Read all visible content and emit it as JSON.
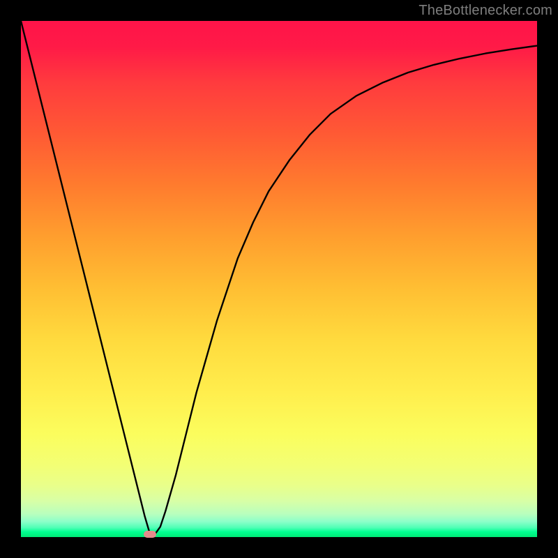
{
  "attribution": "TheBottlenecker.com",
  "chart_data": {
    "type": "line",
    "title": "",
    "xlabel": "",
    "ylabel": "",
    "xlim": [
      0,
      100
    ],
    "ylim": [
      0,
      100
    ],
    "curve": {
      "x": [
        0,
        2,
        4,
        6,
        8,
        10,
        12,
        14,
        16,
        18,
        20,
        22,
        24,
        25,
        26,
        27,
        28,
        30,
        32,
        34,
        36,
        38,
        40,
        42,
        45,
        48,
        52,
        56,
        60,
        65,
        70,
        75,
        80,
        85,
        90,
        95,
        100
      ],
      "y": [
        100,
        92,
        84,
        76,
        68,
        60,
        52,
        44,
        36,
        28,
        20,
        12,
        4,
        0.6,
        0.6,
        2,
        5,
        12,
        20,
        28,
        35,
        42,
        48,
        54,
        61,
        67,
        73,
        78,
        82,
        85.5,
        88,
        90,
        91.5,
        92.7,
        93.7,
        94.5,
        95.2
      ]
    },
    "marker": {
      "x": 25,
      "y": 0.6,
      "color": "#e48b8b"
    },
    "gradient_stops": [
      {
        "pos": 0,
        "color": "#ff1449"
      },
      {
        "pos": 50,
        "color": "#ffbf33"
      },
      {
        "pos": 80,
        "color": "#fbfd5d"
      },
      {
        "pos": 100,
        "color": "#00e876"
      }
    ]
  }
}
